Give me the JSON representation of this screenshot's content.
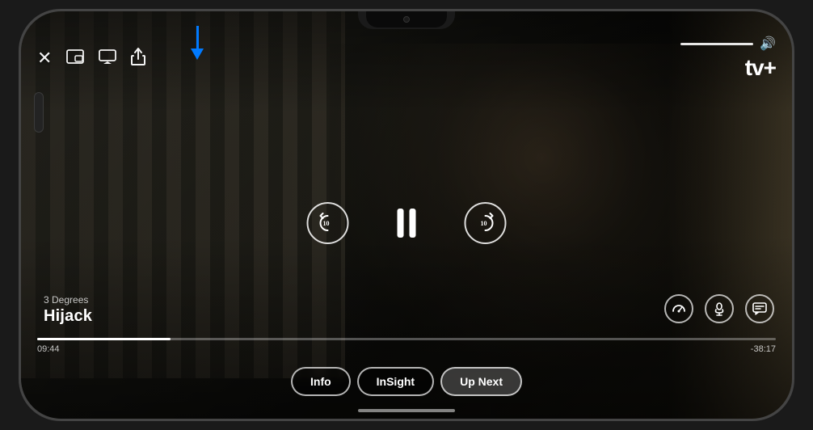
{
  "phone": {
    "frame_color": "#2a2a2e"
  },
  "video": {
    "show_name": "3 Degrees",
    "episode_title": "Hijack",
    "current_time": "09:44",
    "remaining_time": "-38:17",
    "progress_percent": 18
  },
  "controls": {
    "close_label": "✕",
    "pip_label": "⧉",
    "airplay_label": "⬛",
    "share_label": "↑",
    "rewind_seconds": "10",
    "forward_seconds": "10",
    "volume_icon": "🔊",
    "apple_tv_label": "tv+",
    "speed_icon": "⏱",
    "audio_icon": "🎙",
    "subtitles_icon": "💬"
  },
  "tabs": [
    {
      "id": "info",
      "label": "Info"
    },
    {
      "id": "insight",
      "label": "InSight"
    },
    {
      "id": "up-next",
      "label": "Up Next"
    }
  ],
  "arrow": {
    "color": "#007AFF"
  }
}
